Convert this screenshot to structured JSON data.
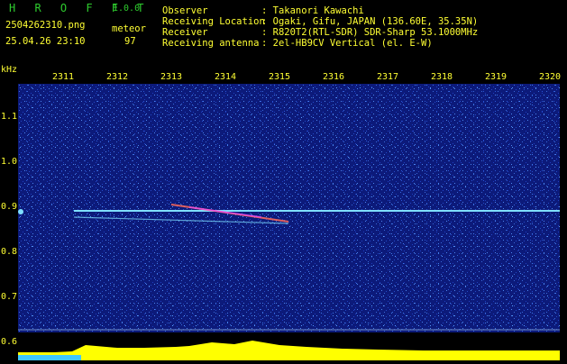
{
  "header": {
    "app_title": "H R O F F T",
    "app_version": "1.0.0",
    "filename": "2504262310.png",
    "datetime": "25.04.26 23:10",
    "meteor_label": "meteor",
    "meteor_count": "97",
    "fields": [
      {
        "label": "Observer",
        "value": ": Takanori Kawachi"
      },
      {
        "label": "Receiving Location",
        "value": ": Ogaki, Gifu, JAPAN (136.60E, 35.35N)"
      },
      {
        "label": "Receiver",
        "value": ": R820T2(RTL-SDR) SDR-Sharp 53.1000MHz"
      },
      {
        "label": "Receiving antenna",
        "value": ": 2el-HB9CV Vertical (el. E-W)"
      }
    ]
  },
  "axes": {
    "y_unit": "kHz",
    "x_ticks": [
      "2311",
      "2312",
      "2313",
      "2314",
      "2315",
      "2316",
      "2317",
      "2318",
      "2319",
      "2320"
    ],
    "y_ticks": [
      "1.1",
      "1.0",
      "0.9",
      "0.8",
      "0.7",
      "0.6"
    ]
  },
  "colors": {
    "background": "#000000",
    "label": "#ffff33",
    "title": "#2ecc2e",
    "spectrogram_bg": "#0c1a7a",
    "trace": "#7fdfff",
    "spectrum": "#ffff00"
  }
}
